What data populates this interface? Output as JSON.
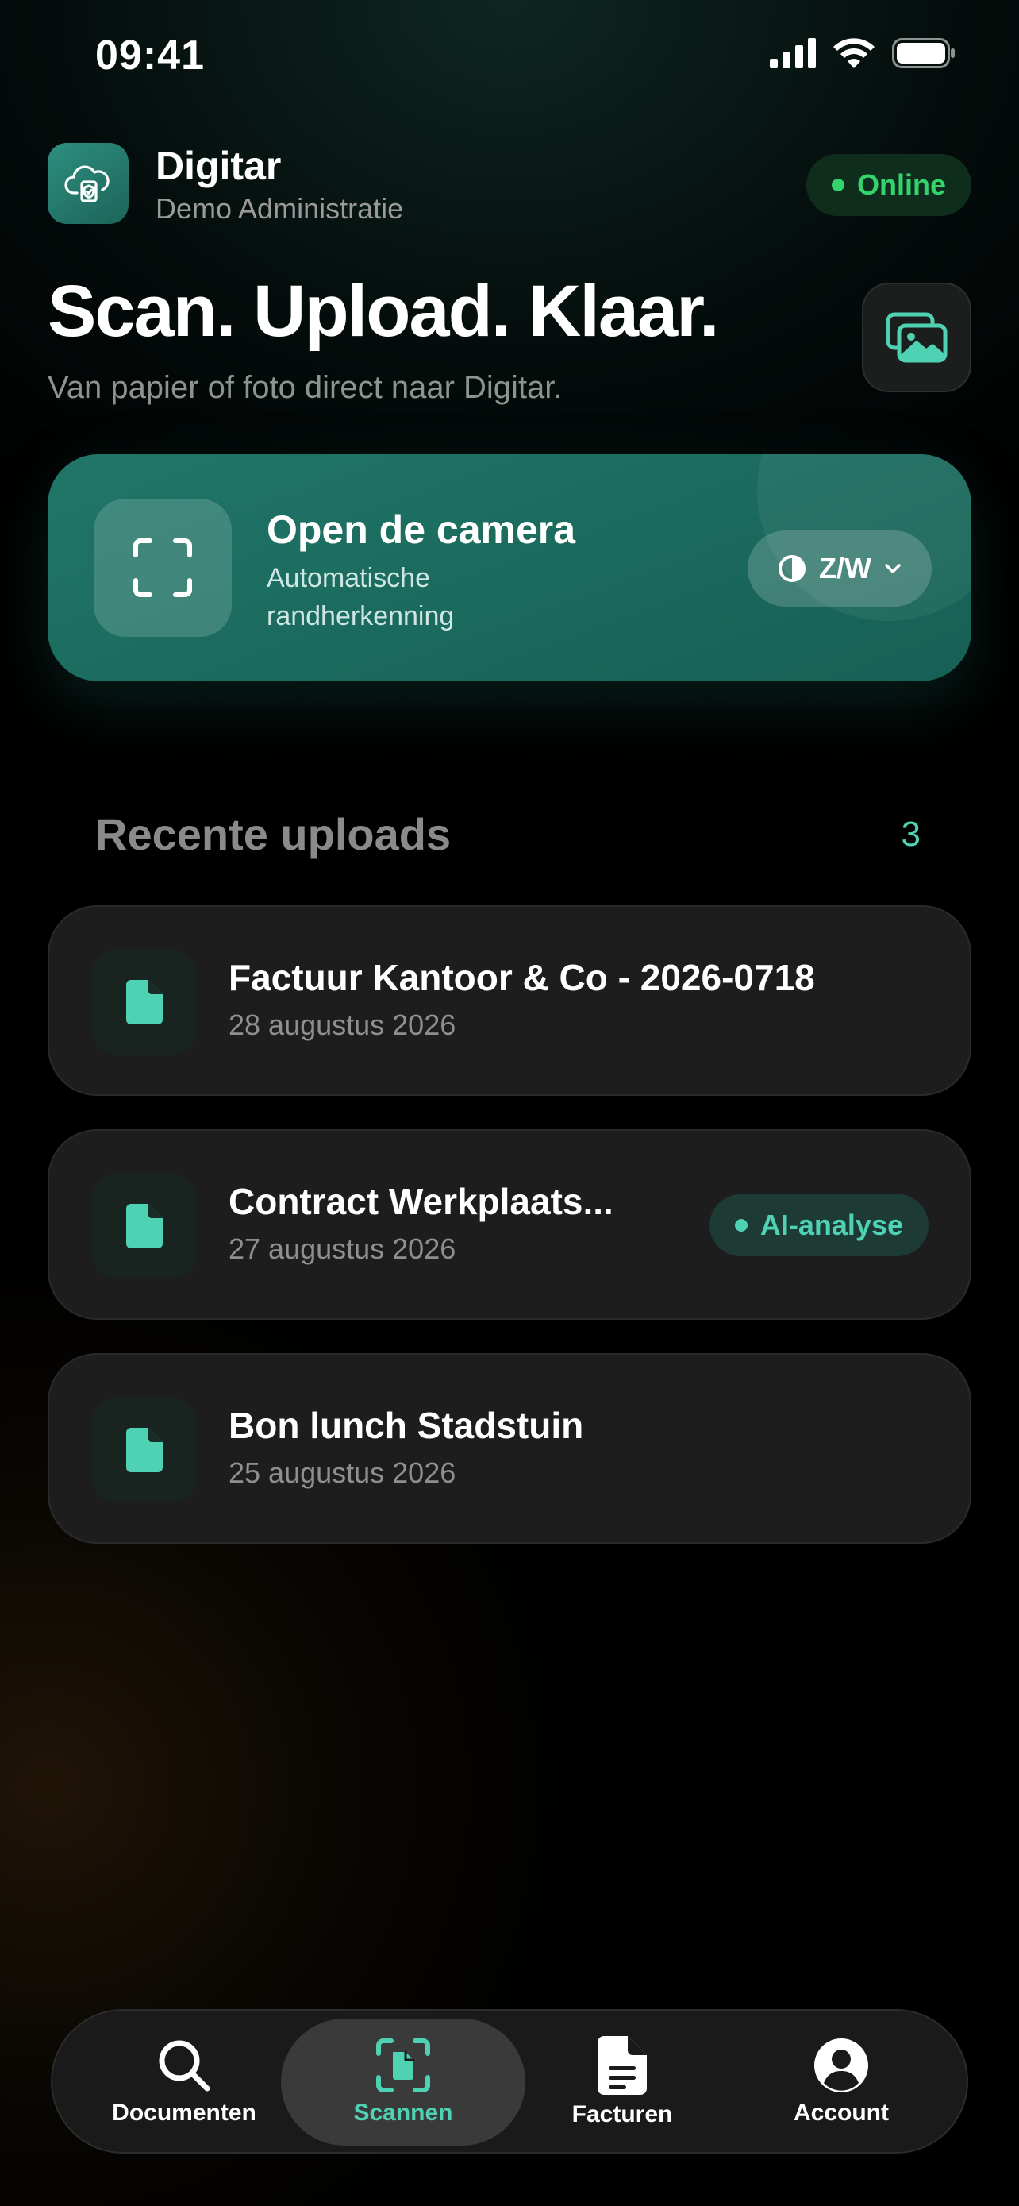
{
  "status_bar": {
    "time": "09:41"
  },
  "header": {
    "app_name": "Digitar",
    "subtitle": "Demo Administratie",
    "status_label": "Online"
  },
  "hero": {
    "title": "Scan. Upload. Klaar.",
    "subtitle": "Van papier of foto direct naar Digitar."
  },
  "camera": {
    "title": "Open de camera",
    "subtitle": "Automatische randherkenning",
    "mode_label": "Z/W"
  },
  "recent": {
    "title": "Recente uploads",
    "count": "3",
    "items": [
      {
        "title": "Factuur Kantoor & Co - 2026-0718",
        "date": "28 augustus 2026",
        "badge": ""
      },
      {
        "title": "Contract Werkplaats...",
        "date": "27 augustus 2026",
        "badge": "AI-analyse"
      },
      {
        "title": "Bon lunch Stadstuin",
        "date": "25 augustus 2026",
        "badge": ""
      }
    ]
  },
  "tabs": [
    {
      "label": "Documenten",
      "icon": "search-icon",
      "active": false
    },
    {
      "label": "Scannen",
      "icon": "scan-document-icon",
      "active": true
    },
    {
      "label": "Facturen",
      "icon": "document-icon",
      "active": false
    },
    {
      "label": "Account",
      "icon": "account-icon",
      "active": false
    }
  ],
  "colors": {
    "accent": "#4fd1b4",
    "card_teal": "#1a6a5d",
    "online_green": "#34d36b",
    "background": "#000000"
  }
}
